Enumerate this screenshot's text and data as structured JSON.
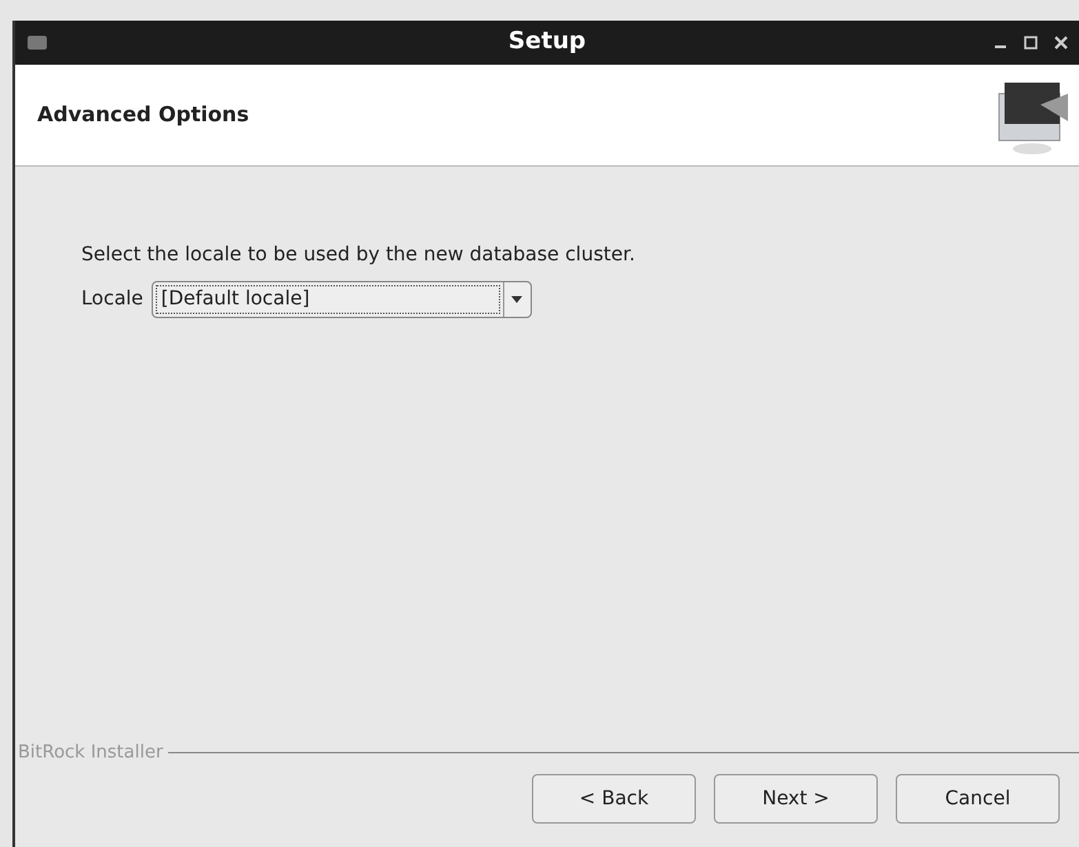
{
  "window": {
    "title": "Setup"
  },
  "header": {
    "title": "Advanced Options"
  },
  "instruction": "Select the locale to be used by the new database cluster.",
  "locale_field": {
    "label": "Locale",
    "value": "[Default locale]"
  },
  "footer": {
    "brand": "BitRock Installer"
  },
  "buttons": [
    {
      "label": "< Back"
    },
    {
      "label": "Next >"
    },
    {
      "label": "Cancel"
    }
  ]
}
